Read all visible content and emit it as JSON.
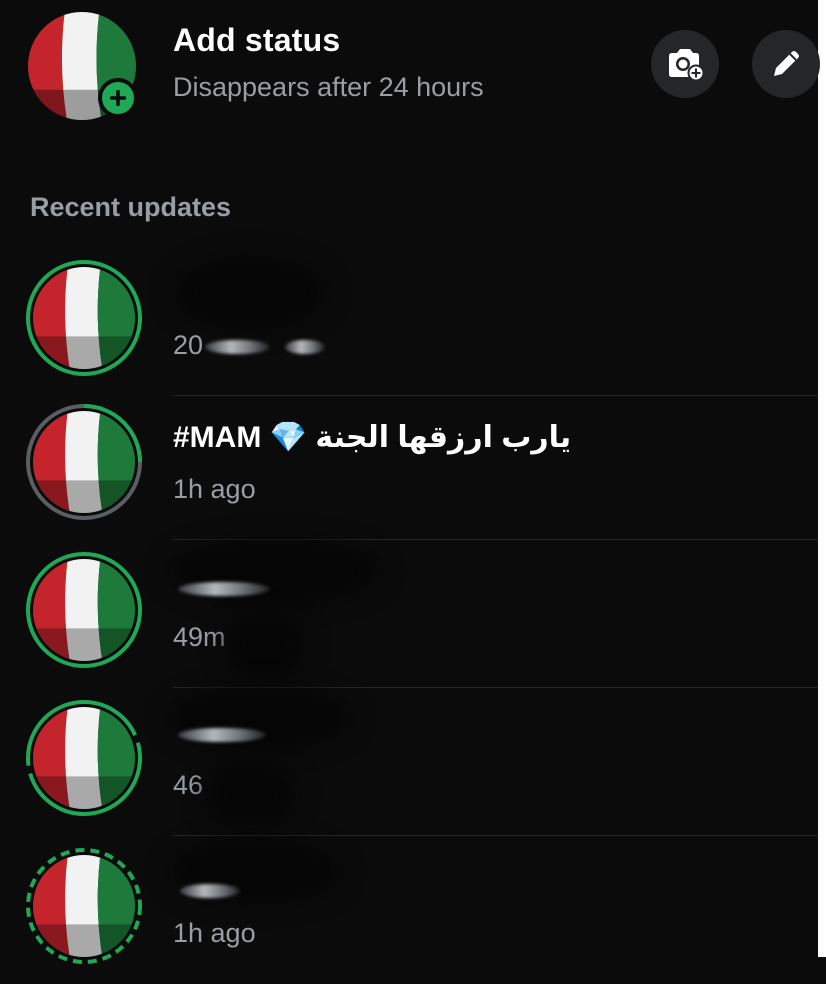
{
  "header": {
    "title": "Add status",
    "subtitle": "Disappears after 24 hours",
    "icons": {
      "camera": "camera-plus-icon",
      "pencil": "pencil-icon",
      "add": "plus-icon"
    }
  },
  "section": {
    "recent_label": "Recent updates"
  },
  "colors": {
    "accent_green": "#1fa855",
    "seen_gray": "#5a5d61",
    "bg": "#0b0b0c",
    "muted": "#9a9ea3"
  },
  "statuses": [
    {
      "name": "",
      "time": "20"
    },
    {
      "name_prefix": "#MAM",
      "emoji": "💎",
      "name_ar": "يارب ارزقها الجنة",
      "time": "1h ago"
    },
    {
      "name": "",
      "time": "49m"
    },
    {
      "name": "",
      "time": "46"
    },
    {
      "name": "",
      "time": "1h ago"
    }
  ]
}
